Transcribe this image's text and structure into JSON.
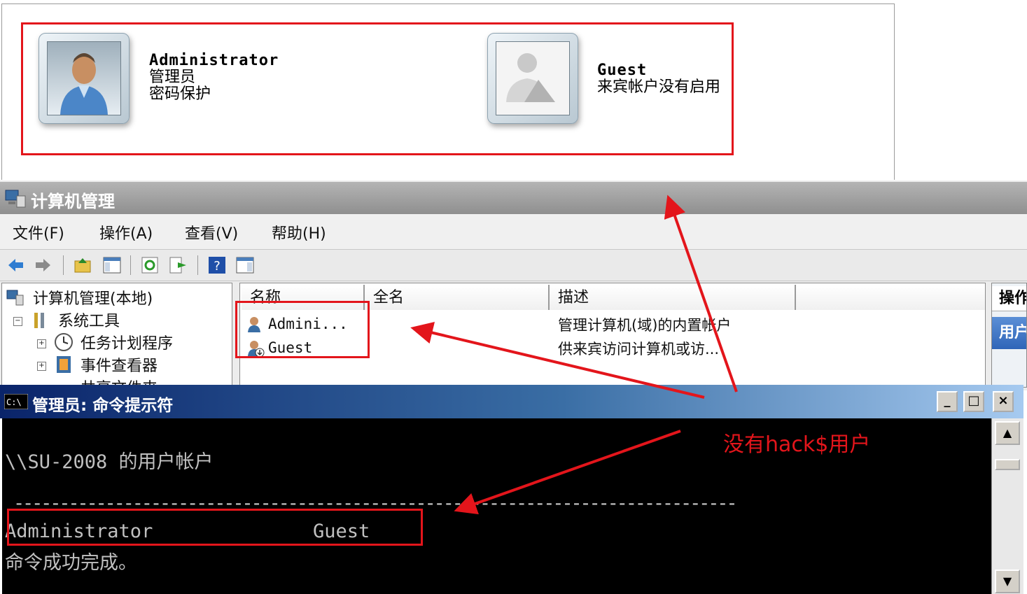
{
  "accounts": [
    {
      "name": "Administrator",
      "role": "管理员",
      "status": "密码保护"
    },
    {
      "name": "Guest",
      "role": "来宾帐户没有启用"
    }
  ],
  "mmc": {
    "title": "计算机管理",
    "menu": [
      "文件(F)",
      "操作(A)",
      "查看(V)",
      "帮助(H)"
    ],
    "tree": {
      "root": "计算机管理(本地)",
      "system_tools": "系统工具",
      "task_scheduler": "任务计划程序",
      "event_viewer": "事件查看器",
      "shared_folders": "共享文件夹"
    },
    "columns": [
      "名称",
      "全名",
      "描述"
    ],
    "users": [
      {
        "name": "Admini...",
        "fullname": "",
        "desc": "管理计算机(域)的内置帐户"
      },
      {
        "name": "Guest",
        "fullname": "",
        "desc": "供来宾访问计算机或访..."
      }
    ],
    "actions_header": "操作",
    "actions_item": "用户"
  },
  "cmd": {
    "title": "管理员: 命令提示符",
    "lines": {
      "header": "\\\\SU-2008 的用户帐户",
      "separator": "-------------------------------------------------------------------------------",
      "account_admin": "Administrator",
      "account_guest": "Guest",
      "done": "命令成功完成。"
    },
    "buttons": {
      "minimize": "_",
      "maximize": "□",
      "close": "×"
    }
  },
  "annotation": "没有hack$用户",
  "colors": {
    "annotation_red": "#e3151b",
    "cmd_title_blue": "#0a246a"
  }
}
